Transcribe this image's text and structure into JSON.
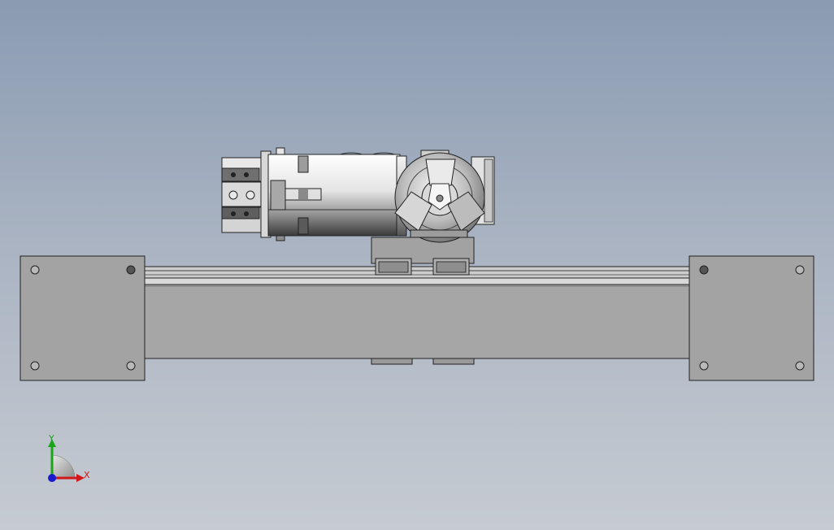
{
  "view": {
    "background_top": "#8a9bb2",
    "background_bottom": "#c6cbd2"
  },
  "model": {
    "parts": [
      "linear-actuator-rail",
      "end-plate-left",
      "end-plate-right",
      "carriage",
      "motor",
      "three-jaw-chuck"
    ]
  },
  "triad": {
    "x_label": "X",
    "y_label": "Y",
    "x_color": "#d0171b",
    "y_color": "#1aa51a",
    "z_color": "#1a1ad0"
  }
}
